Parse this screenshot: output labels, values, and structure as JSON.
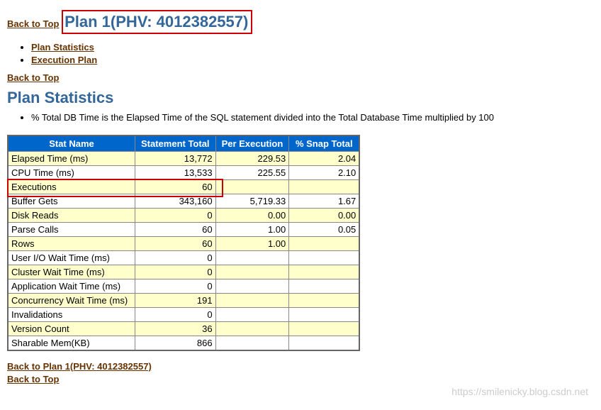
{
  "links": {
    "back_to_top": "Back to Top",
    "plan_statistics": "Plan Statistics",
    "execution_plan": "Execution Plan",
    "back_to_plan": "Back to Plan 1(PHV: 4012382557)"
  },
  "headings": {
    "plan_title": "Plan 1(PHV: 4012382557)",
    "stats_title": "Plan Statistics"
  },
  "notes": {
    "db_time_note": "% Total DB Time is the Elapsed Time of the SQL statement divided into the Total Database Time multiplied by 100"
  },
  "table": {
    "headers": {
      "stat_name": "Stat Name",
      "statement_total": "Statement Total",
      "per_execution": "Per Execution",
      "snap_total": "% Snap Total"
    },
    "rows": [
      {
        "name": "Elapsed Time (ms)",
        "total": "13,772",
        "per_exec": "229.53",
        "snap": "2.04",
        "alt": true
      },
      {
        "name": "CPU Time (ms)",
        "total": "13,533",
        "per_exec": "225.55",
        "snap": "2.10",
        "alt": false
      },
      {
        "name": "Executions",
        "total": "60",
        "per_exec": "",
        "snap": "",
        "alt": true,
        "highlight": true
      },
      {
        "name": "Buffer Gets",
        "total": "343,160",
        "per_exec": "5,719.33",
        "snap": "1.67",
        "alt": false
      },
      {
        "name": "Disk Reads",
        "total": "0",
        "per_exec": "0.00",
        "snap": "0.00",
        "alt": true
      },
      {
        "name": "Parse Calls",
        "total": "60",
        "per_exec": "1.00",
        "snap": "0.05",
        "alt": false
      },
      {
        "name": "Rows",
        "total": "60",
        "per_exec": "1.00",
        "snap": "",
        "alt": true
      },
      {
        "name": "User I/O Wait Time (ms)",
        "total": "0",
        "per_exec": "",
        "snap": "",
        "alt": false
      },
      {
        "name": "Cluster Wait Time (ms)",
        "total": "0",
        "per_exec": "",
        "snap": "",
        "alt": true
      },
      {
        "name": "Application Wait Time (ms)",
        "total": "0",
        "per_exec": "",
        "snap": "",
        "alt": false
      },
      {
        "name": "Concurrency Wait Time (ms)",
        "total": "191",
        "per_exec": "",
        "snap": "",
        "alt": true
      },
      {
        "name": "Invalidations",
        "total": "0",
        "per_exec": "",
        "snap": "",
        "alt": false
      },
      {
        "name": "Version Count",
        "total": "36",
        "per_exec": "",
        "snap": "",
        "alt": true
      },
      {
        "name": "Sharable Mem(KB)",
        "total": "866",
        "per_exec": "",
        "snap": "",
        "alt": false
      }
    ]
  },
  "watermark": "https://smilenicky.blog.csdn.net"
}
